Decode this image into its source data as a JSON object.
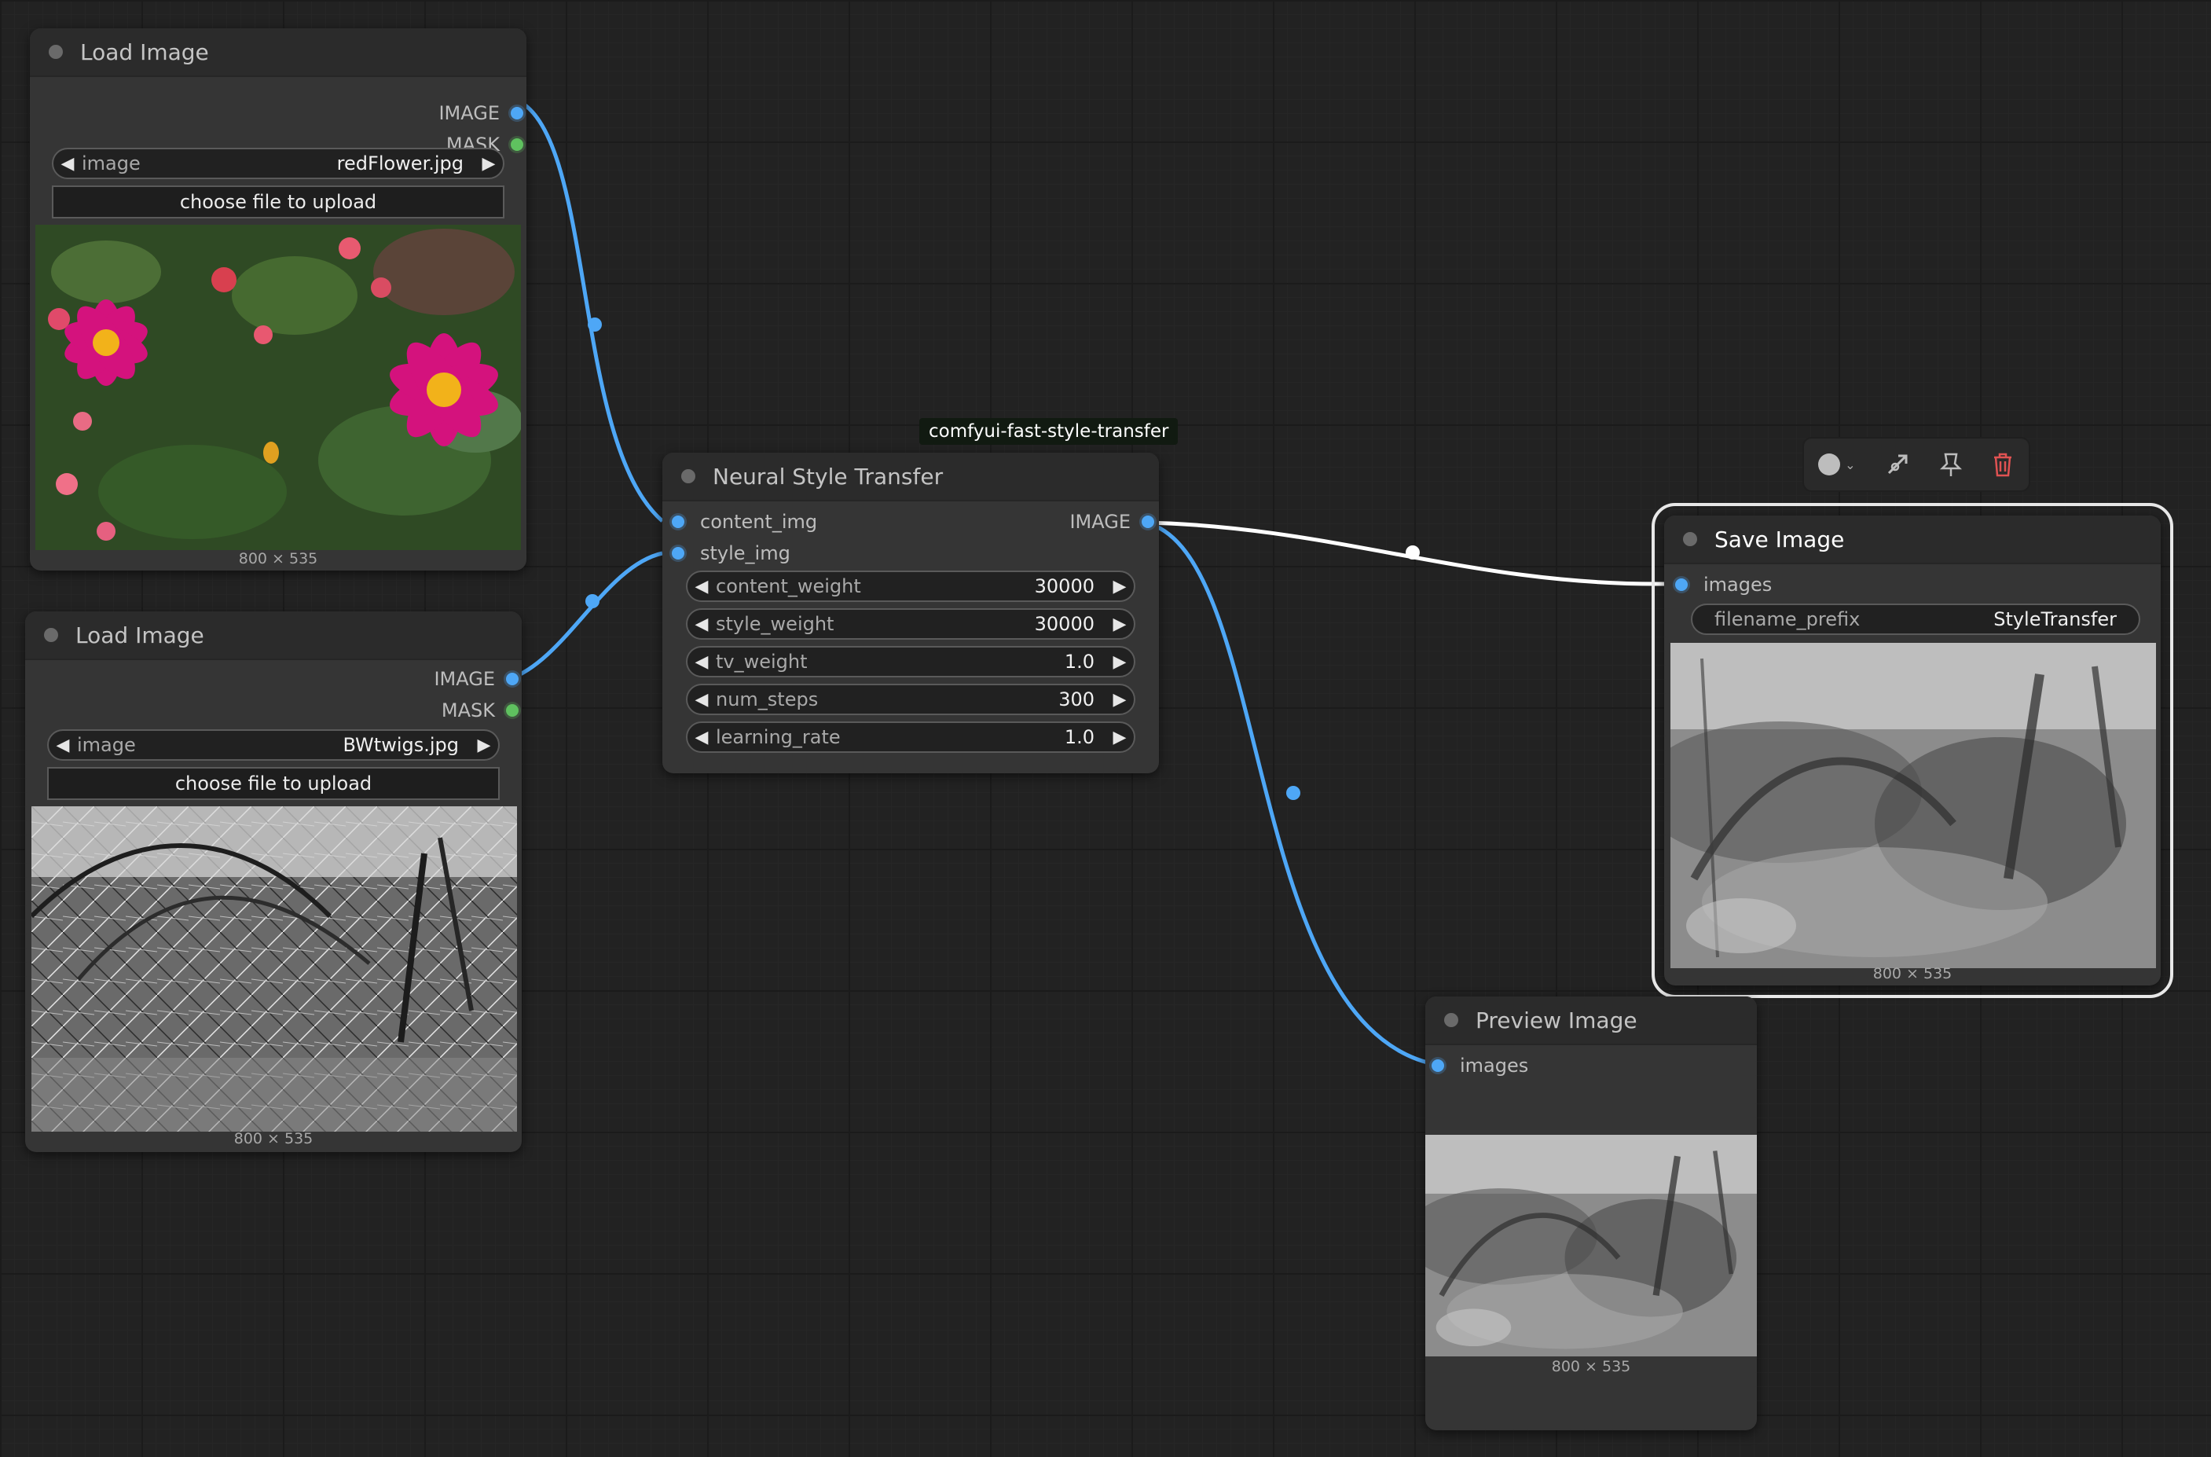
{
  "nodes": {
    "load1": {
      "title": "Load Image",
      "outputs": [
        "IMAGE",
        "MASK"
      ],
      "widget_label": "image",
      "widget_value": "redFlower.jpg",
      "upload_label": "choose file to upload",
      "dims": "800 × 535"
    },
    "load2": {
      "title": "Load Image",
      "outputs": [
        "IMAGE",
        "MASK"
      ],
      "widget_label": "image",
      "widget_value": "BWtwigs.jpg",
      "upload_label": "choose file to upload",
      "dims": "800 × 535"
    },
    "nst": {
      "badge": "comfyui-fast-style-transfer",
      "title": "Neural Style Transfer",
      "inputs": [
        "content_img",
        "style_img"
      ],
      "output": "IMAGE",
      "params": [
        {
          "label": "content_weight",
          "value": "30000"
        },
        {
          "label": "style_weight",
          "value": "30000"
        },
        {
          "label": "tv_weight",
          "value": "1.0"
        },
        {
          "label": "num_steps",
          "value": "300"
        },
        {
          "label": "learning_rate",
          "value": "1.0"
        }
      ]
    },
    "save": {
      "title": "Save Image",
      "input": "images",
      "widget_label": "filename_prefix",
      "widget_value": "StyleTransfer",
      "dims": "800 × 535"
    },
    "preview": {
      "title": "Preview Image",
      "input": "images",
      "dims": "800 × 535"
    }
  },
  "toolbar": {
    "icons": [
      "color-circle-icon",
      "chevron-down-icon",
      "bypass-icon",
      "pin-icon",
      "trash-icon"
    ]
  },
  "colors": {
    "image_link": "#4ea7f6",
    "mask_socket": "#5fc15f",
    "selected_link": "#ffffff",
    "trash": "#e05252"
  }
}
